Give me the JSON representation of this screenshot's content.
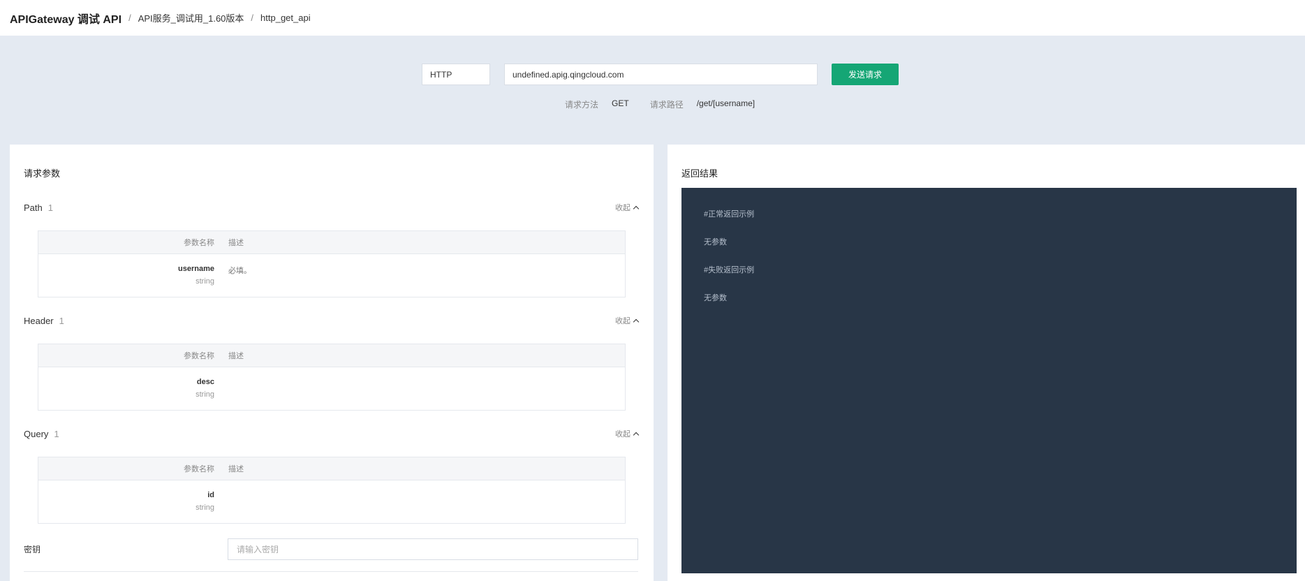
{
  "breadcrumb": {
    "title": "APIGateway 调试 API",
    "sep": "/",
    "service": "API服务_调试用_1.60版本",
    "api": "http_get_api"
  },
  "request": {
    "protocol": "HTTP",
    "host": "undefined.apig.qingcloud.com",
    "send_label": "发送请求",
    "method_label": "请求方法",
    "method": "GET",
    "path_label": "请求路径",
    "path": "/get/[username]"
  },
  "params": {
    "title": "请求参数",
    "collapse_label": "收起",
    "col_name": "参数名称",
    "col_desc": "描述",
    "path": {
      "name": "Path",
      "count": "1",
      "rows": [
        {
          "name": "username",
          "type": "string",
          "desc": "必填。"
        }
      ]
    },
    "header": {
      "name": "Header",
      "count": "1",
      "rows": [
        {
          "name": "desc",
          "type": "string",
          "desc": ""
        }
      ]
    },
    "query": {
      "name": "Query",
      "count": "1",
      "rows": [
        {
          "name": "id",
          "type": "string",
          "desc": ""
        }
      ]
    },
    "secret": {
      "label": "密钥",
      "placeholder": "请输入密钥",
      "value": ""
    }
  },
  "result": {
    "title": "返回结果",
    "lines": [
      "#正常返回示例",
      "无参数",
      "#失败返回示例",
      "无参数"
    ]
  },
  "colors": {
    "accent": "#15a675",
    "code_bg": "#283647",
    "page_bg": "#e4eaf2"
  }
}
